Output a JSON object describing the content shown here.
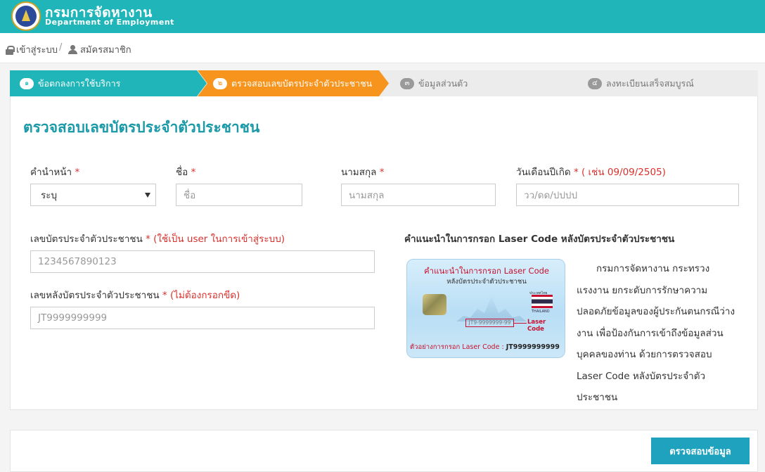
{
  "header": {
    "brand_th": "กรมการจัดหางาน",
    "brand_en": "Department of Employment"
  },
  "breadcrumb": {
    "login_label": "เข้าสู่ระบบ",
    "separator": "/",
    "register_label": "สมัครสมาชิก"
  },
  "steps": [
    {
      "num": "๑",
      "label": "ข้อตกลงการใช้บริการ",
      "state": "done"
    },
    {
      "num": "๒",
      "label": "ตรวจสอบเลขบัตรประจำตัวประชาชน",
      "state": "active"
    },
    {
      "num": "๓",
      "label": "ข้อมูลส่วนตัว",
      "state": "pending"
    },
    {
      "num": "๔",
      "label": "ลงทะเบียนเสร็จสมบูรณ์",
      "state": "pending"
    }
  ],
  "page_title": "ตรวจสอบเลขบัตรประจำตัวประชาชน",
  "form": {
    "prefix": {
      "label": "คำนำหน้า",
      "required": "*",
      "selected": "ระบุ"
    },
    "firstname": {
      "label": "ชื่อ",
      "required": "*",
      "placeholder": "ชื่อ"
    },
    "lastname": {
      "label": "นามสกุล",
      "required": "*",
      "placeholder": "นามสกุล"
    },
    "birthdate": {
      "label": "วันเดือนปีเกิด",
      "required": "*",
      "hint": "( เช่น 09/09/2505)",
      "placeholder": "วว/ดด/ปปปป"
    },
    "id_number": {
      "label": "เลขบัตรประจำตัวประชาชน",
      "required": "*",
      "hint": "(ใช้เป็น user ในการเข้าสู่ระบบ)",
      "placeholder": "1234567890123"
    },
    "laser_code": {
      "label": "เลขหลังบัตรประจำตัวประชาชน",
      "required": "*",
      "hint": "(ไม่ต้องกรอกขีด)",
      "placeholder": "JT9999999999"
    }
  },
  "guide": {
    "title": "คำแนะนำในการกรอก Laser Code หลังบัตรประจำตัวประชาชน",
    "card_title": "คำแนะนำในการกรอก Laser Code",
    "card_subtitle": "หลังบัตรประจำตัวประชาชน",
    "card_small_text": "ประเทศไทย",
    "card_country": "THAILAND",
    "card_laser_sample": "JT9-9999999-99",
    "card_laser_label": "Laser Code",
    "card_example_prefix": "ตัวอย่างการกรอก Laser Code :",
    "card_example_value": "JT9999999999",
    "description": "กรมการจัดหางาน กระทรวงแรงงาน ยกระดับการรักษาความปลอดภัยข้อมูลของผู้ประกันตนกรณีว่างงาน เพื่อป้องกันการเข้าถึงข้อมูลส่วนบุคคลของท่าน ด้วยการตรวจสอบ Laser Code หลังบัตรประจำตัวประชาชน"
  },
  "submit_label": "ตรวจสอบข้อมูล",
  "colors": {
    "primary": "#1fb5b9",
    "active_step": "#f7941d",
    "title": "#1a9aa8",
    "required": "#d9302b",
    "button": "#1fa2bd"
  }
}
